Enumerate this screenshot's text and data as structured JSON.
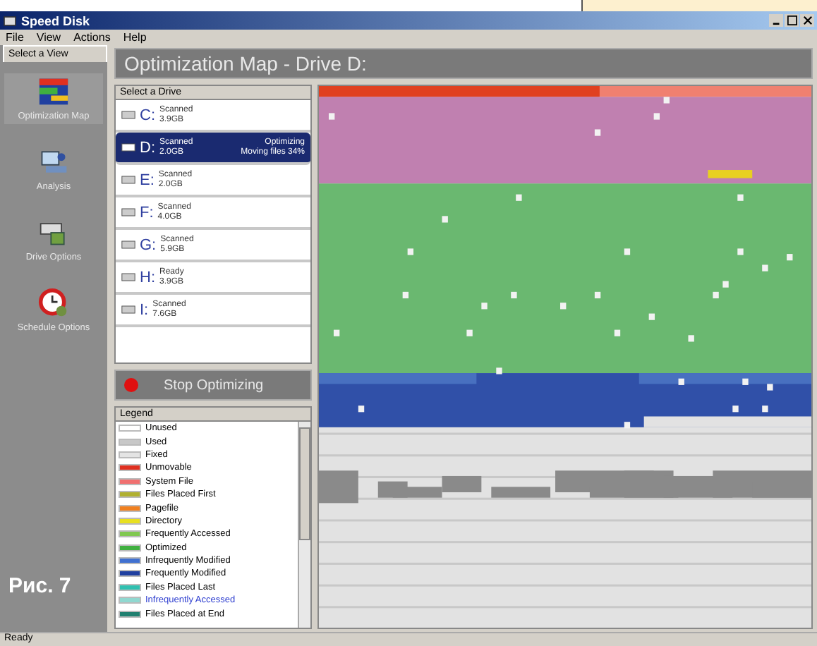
{
  "window": {
    "title": "Speed Disk"
  },
  "menu": [
    "File",
    "View",
    "Actions",
    "Help"
  ],
  "sidebar": {
    "tab": "Select a View",
    "items": [
      {
        "label": "Optimization Map",
        "kind": "map",
        "selected": true
      },
      {
        "label": "Analysis",
        "kind": "analysis",
        "selected": false
      },
      {
        "label": "Drive Options",
        "kind": "drive",
        "selected": false
      },
      {
        "label": "Schedule Options",
        "kind": "schedule",
        "selected": false
      }
    ]
  },
  "panel_title": "Optimization Map - Drive D:",
  "drive_list": {
    "header": "Select a Drive",
    "drives": [
      {
        "letter": "C:",
        "status": "Scanned",
        "size": "3.9GB",
        "selected": false
      },
      {
        "letter": "D:",
        "status": "Scanned",
        "size": "2.0GB",
        "activity": "Optimizing",
        "progress": "Moving files 34%",
        "selected": true
      },
      {
        "letter": "E:",
        "status": "Scanned",
        "size": "2.0GB",
        "selected": false
      },
      {
        "letter": "F:",
        "status": "Scanned",
        "size": "4.0GB",
        "selected": false
      },
      {
        "letter": "G:",
        "status": "Scanned",
        "size": "5.9GB",
        "selected": false
      },
      {
        "letter": "H:",
        "status": "Ready",
        "size": "3.9GB",
        "selected": false
      },
      {
        "letter": "I:",
        "status": "Scanned",
        "size": "7.6GB",
        "selected": false
      }
    ]
  },
  "stop_button": "Stop Optimizing",
  "legend": {
    "header": "Legend",
    "items": [
      {
        "label": "Unused",
        "color": "#ffffff",
        "selected": false
      },
      {
        "label": "Used",
        "color": "#c8c8c8",
        "selected": false
      },
      {
        "label": "Fixed",
        "color": "#e4e4e4",
        "selected": false
      },
      {
        "label": "Unmovable",
        "color": "#e03020",
        "selected": false
      },
      {
        "label": "System File",
        "color": "#f07070",
        "selected": false
      },
      {
        "label": "Files Placed First",
        "color": "#b0b030",
        "selected": false
      },
      {
        "label": "Pagefile",
        "color": "#f08020",
        "selected": false
      },
      {
        "label": "Directory",
        "color": "#e8e020",
        "selected": false
      },
      {
        "label": "Frequently Accessed",
        "color": "#80c850",
        "selected": false
      },
      {
        "label": "Optimized",
        "color": "#40b040",
        "selected": false
      },
      {
        "label": "Infrequently Modified",
        "color": "#4070d0",
        "selected": false
      },
      {
        "label": "Frequently Modified",
        "color": "#2040a0",
        "selected": false
      },
      {
        "label": "Files Placed Last",
        "color": "#30c0b0",
        "selected": false
      },
      {
        "label": "Infrequently Accessed",
        "color": "#90d8d0",
        "selected": true
      },
      {
        "label": "Files Placed at End",
        "color": "#208070",
        "selected": false
      }
    ]
  },
  "status_bar": "Ready",
  "figure_caption": "Рис. 7"
}
